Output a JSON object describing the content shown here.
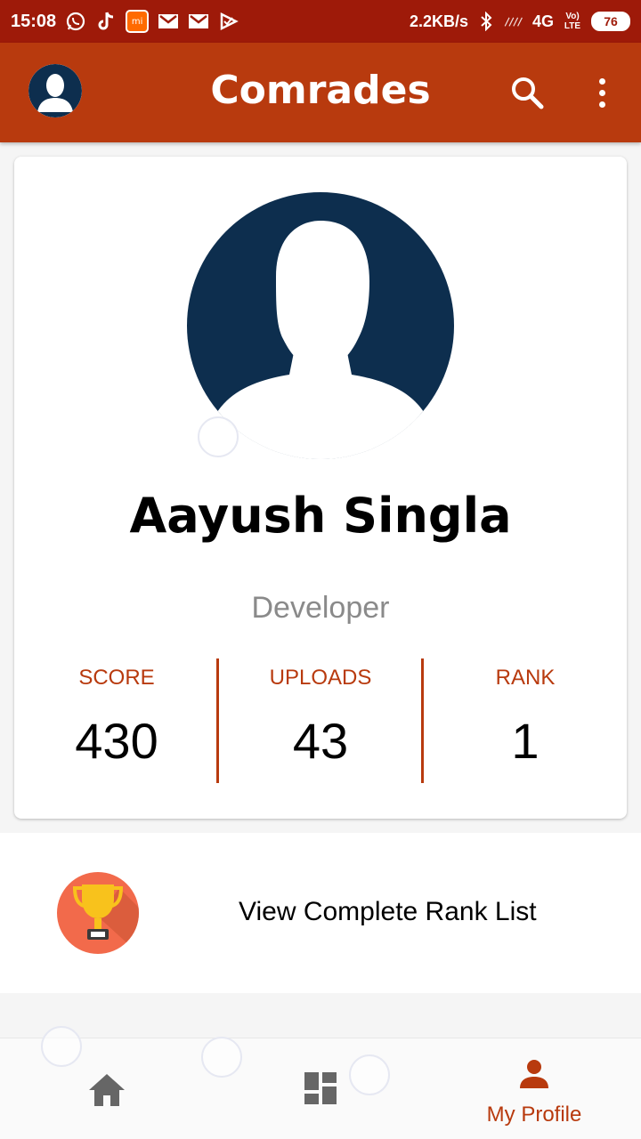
{
  "status_bar": {
    "time": "15:08",
    "network_speed": "2.2KB/s",
    "network_type": "4G",
    "volte": "Vo) LTE",
    "battery": "76",
    "icons": [
      "whatsapp-icon",
      "tiktok-icon",
      "mi-icon",
      "gmail-icon",
      "gmail-icon",
      "task-icon",
      "bluetooth-icon",
      "signal-icon"
    ]
  },
  "app_bar": {
    "title": "Comrades",
    "icons": [
      "avatar-icon",
      "search-icon",
      "more-vert-icon"
    ]
  },
  "profile": {
    "name": "Aayush Singla",
    "role": "Developer",
    "stats": [
      {
        "label": "SCORE",
        "value": "430"
      },
      {
        "label": "UPLOADS",
        "value": "43"
      },
      {
        "label": "RANK",
        "value": "1"
      }
    ]
  },
  "rank_list": {
    "label": "View Complete Rank List",
    "icon": "trophy-icon"
  },
  "bottom_nav": {
    "items": [
      {
        "icon": "home-icon",
        "label": ""
      },
      {
        "icon": "dashboard-icon",
        "label": ""
      },
      {
        "icon": "person-icon",
        "label": "My Profile",
        "active": true
      }
    ]
  },
  "colors": {
    "status_bar": "#9e1a09",
    "app_bar": "#b83a0e",
    "accent": "#b83a0e",
    "avatar_bg": "#0d2e4e",
    "trophy_bg": "#f26a4b"
  }
}
